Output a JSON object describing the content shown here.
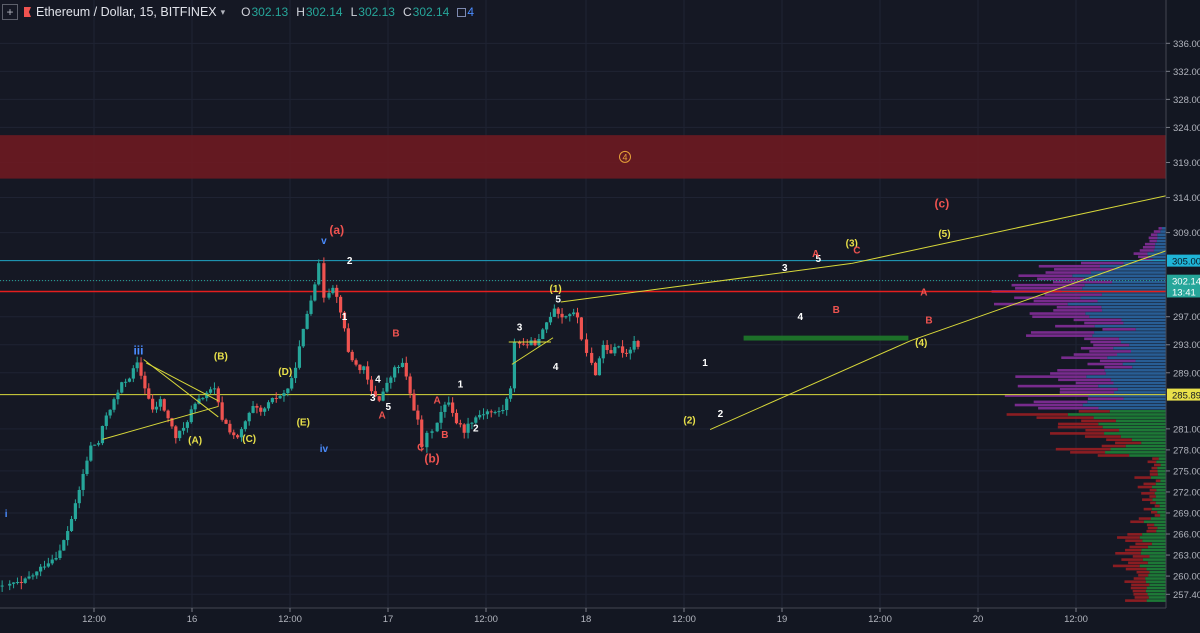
{
  "header": {
    "symbol_title": "Ethereum / Dollar, 15, BITFINEX",
    "open_label": "O",
    "open_value": "302.13",
    "high_label": "H",
    "high_value": "302.14",
    "low_label": "L",
    "low_value": "302.13",
    "close_label": "C",
    "close_value": "302.14",
    "indicator_count": "4"
  },
  "colors": {
    "background": "#131722",
    "up": "#26a69a",
    "down": "#ef5350",
    "resistance_zone": "#6b1a22",
    "trendline": "#d8d83a",
    "wave_white": "#ffffff",
    "wave_yellow": "#e8e04a",
    "wave_red": "#ef5350",
    "wave_blue": "#4a8cff"
  },
  "chart_data": {
    "type": "candlestick",
    "y_ticks": [
      "336.00",
      "332.00",
      "328.00",
      "324.00",
      "319.00",
      "314.00",
      "309.00",
      "305.00",
      "302.14",
      "297.00",
      "293.00",
      "289.00",
      "285.89",
      "281.00",
      "278.00",
      "275.00",
      "272.00",
      "269.00",
      "266.00",
      "263.00",
      "260.00",
      "257.40"
    ],
    "x_ticks": [
      "12:00",
      "16",
      "12:00",
      "17",
      "12:00",
      "18",
      "12:00",
      "19",
      "12:00",
      "20",
      "12:00"
    ],
    "last_price": "302.14",
    "countdown": "13:41",
    "line_305": "305.00",
    "line_285": "285.89",
    "zone_label": "4",
    "close_path": [
      [
        0.03,
        258.6
      ],
      [
        1.5,
        258.3
      ],
      [
        3,
        259
      ],
      [
        4.5,
        258.8
      ],
      [
        6,
        259.8
      ],
      [
        7.5,
        260.5
      ],
      [
        9,
        261.7
      ],
      [
        10.5,
        262.5
      ],
      [
        12,
        263.5
      ],
      [
        13.5,
        266.5
      ],
      [
        15,
        270
      ],
      [
        16.5,
        274.5
      ],
      [
        18,
        278.5
      ],
      [
        19.5,
        279
      ],
      [
        21,
        283
      ],
      [
        22.5,
        285
      ],
      [
        24,
        287.3
      ],
      [
        25.5,
        288.5
      ],
      [
        27,
        290.2
      ],
      [
        28.5,
        287
      ],
      [
        30,
        283.5
      ],
      [
        31.5,
        285
      ],
      [
        33,
        282.5
      ],
      [
        34.5,
        279.8
      ],
      [
        36,
        281
      ],
      [
        37.5,
        283.6
      ],
      [
        39,
        285
      ],
      [
        40.5,
        286.2
      ],
      [
        42,
        286.5
      ],
      [
        43.5,
        282.5
      ],
      [
        45,
        280.8
      ],
      [
        46.5,
        279.5
      ],
      [
        48,
        282
      ],
      [
        49.5,
        284
      ],
      [
        51,
        283.2
      ],
      [
        52.5,
        284.5
      ],
      [
        54,
        285.5
      ],
      [
        55.5,
        286
      ],
      [
        57,
        287.8
      ],
      [
        58.5,
        292.5
      ],
      [
        60,
        297.5
      ],
      [
        61.5,
        302
      ],
      [
        62.5,
        304.2
      ],
      [
        63.5,
        300
      ],
      [
        65,
        301.5
      ],
      [
        66.5,
        298
      ],
      [
        68,
        292
      ],
      [
        69.5,
        290
      ],
      [
        71,
        289.5
      ],
      [
        72.5,
        286.2
      ],
      [
        74,
        285.3
      ],
      [
        75.5,
        287.3
      ],
      [
        77,
        289.5
      ],
      [
        78.5,
        290.3
      ],
      [
        80,
        286
      ],
      [
        81.5,
        282
      ],
      [
        82.5,
        278.5
      ],
      [
        83.5,
        280
      ],
      [
        84.5,
        281
      ],
      [
        86,
        283.3
      ],
      [
        87.5,
        285
      ],
      [
        89,
        282
      ],
      [
        90.5,
        280.8
      ],
      [
        92,
        282.3
      ],
      [
        93.5,
        283.1
      ],
      [
        95,
        283.5
      ],
      [
        96.5,
        283.2
      ],
      [
        98,
        283.8
      ],
      [
        99.5,
        286.5
      ],
      [
        100.5,
        293.6
      ],
      [
        102,
        293
      ],
      [
        103.5,
        293.2
      ],
      [
        105,
        293.5
      ],
      [
        106.5,
        296.2
      ],
      [
        108,
        298.4
      ],
      [
        109.5,
        297
      ],
      [
        111,
        297.5
      ],
      [
        112.5,
        297
      ],
      [
        113.5,
        294
      ],
      [
        114.5,
        291.5
      ],
      [
        116,
        289
      ],
      [
        117.5,
        293
      ],
      [
        119,
        292
      ],
      [
        120.5,
        292.5
      ],
      [
        122,
        291.8
      ],
      [
        123.5,
        293.5
      ],
      [
        125,
        292.5
      ],
      [
        126.5,
        293
      ],
      [
        128,
        291.5
      ],
      [
        129.5,
        293
      ],
      [
        131,
        293
      ],
      [
        132.5,
        292.5
      ],
      [
        134,
        289.5
      ],
      [
        135.5,
        283.8
      ],
      [
        137,
        281.8
      ],
      [
        138.5,
        284.8
      ],
      [
        140,
        286.8
      ],
      [
        141,
        283.2
      ],
      [
        142.5,
        285
      ],
      [
        144,
        288
      ],
      [
        145.5,
        290.8
      ],
      [
        147,
        293.6
      ],
      [
        148.5,
        295.5
      ],
      [
        150,
        297
      ],
      [
        151.5,
        298.5
      ],
      [
        153,
        299
      ],
      [
        154,
        301
      ],
      [
        155.5,
        300
      ],
      [
        157,
        298.2
      ],
      [
        158.5,
        297.9
      ],
      [
        160,
        302.4
      ],
      [
        161.5,
        300.5
      ],
      [
        163,
        300.5
      ],
      [
        164.5,
        301.2
      ],
      [
        165.5,
        302.5
      ],
      [
        167,
        298
      ],
      [
        168.5,
        298.3
      ],
      [
        170,
        299.5
      ],
      [
        171.5,
        300.2
      ],
      [
        173,
        298
      ],
      [
        174.5,
        297
      ],
      [
        175.5,
        293.5
      ],
      [
        176.5,
        296
      ],
      [
        178,
        299.5
      ],
      [
        179.5,
        300.5
      ],
      [
        180.5,
        303.5
      ],
      [
        181.5,
        305
      ],
      [
        182.5,
        300
      ],
      [
        183.5,
        304.5
      ],
      [
        184.5,
        302.5
      ],
      [
        185.5,
        302.1
      ],
      [
        187,
        302.14
      ]
    ],
    "trendlines": [
      [
        [
          27.5,
          290.9
        ],
        [
          42,
          282.7
        ]
      ],
      [
        [
          28,
          290.4
        ],
        [
          42,
          285.0
        ]
      ],
      [
        [
          19.5,
          279.5
        ],
        [
          42,
          284.2
        ]
      ],
      [
        [
          108.5,
          299.1
        ],
        [
          165,
          304.6
        ]
      ],
      [
        [
          165,
          304.6
        ],
        [
          232,
          315.2
        ]
      ],
      [
        [
          137.5,
          280.9
        ],
        [
          176.5,
          293.6
        ]
      ],
      [
        [
          176.5,
          293.6
        ],
        [
          245,
          311.3
        ]
      ],
      [
        [
          98.4,
          293.4
        ],
        [
          106.6,
          293.4
        ]
      ],
      [
        [
          99,
          290.2
        ],
        [
          107,
          294.0
        ]
      ]
    ],
    "green_zone": [
      [
        144,
        293.6
      ],
      [
        176,
        294.3
      ]
    ],
    "wave_labels": [
      {
        "t": "i",
        "d": 0.8,
        "p": 268.4,
        "c": "blue"
      },
      {
        "t": "iii",
        "d": 26.5,
        "p": 291.6,
        "c": "blue"
      },
      {
        "t": "v",
        "d": 62.5,
        "p": 307.4,
        "c": "blue"
      },
      {
        "t": "iv",
        "d": 62.5,
        "p": 277.7,
        "c": "blue"
      },
      {
        "t": "(a)",
        "d": 65,
        "p": 308.8,
        "c": "red"
      },
      {
        "t": "(b)",
        "d": 83.5,
        "p": 276.2,
        "c": "red"
      },
      {
        "t": "(c)",
        "d": 182.5,
        "p": 312.6,
        "c": "red"
      },
      {
        "t": "(B)",
        "d": 42.5,
        "p": 290.9,
        "c": "yellow"
      },
      {
        "t": "(D)",
        "d": 55,
        "p": 288.7,
        "c": "yellow"
      },
      {
        "t": "(A)",
        "d": 37.5,
        "p": 278.9,
        "c": "yellow"
      },
      {
        "t": "(C)",
        "d": 48,
        "p": 279.1,
        "c": "yellow"
      },
      {
        "t": "(E)",
        "d": 58.5,
        "p": 281.5,
        "c": "yellow"
      },
      {
        "t": "(1)",
        "d": 107.5,
        "p": 300.5,
        "c": "yellow"
      },
      {
        "t": "(2)",
        "d": 133.5,
        "p": 281.8,
        "c": "yellow"
      },
      {
        "t": "(3)",
        "d": 165,
        "p": 307.0,
        "c": "yellow"
      },
      {
        "t": "(4)",
        "d": 178.5,
        "p": 292.8,
        "c": "yellow"
      },
      {
        "t": "(5)",
        "d": 183,
        "p": 308.4,
        "c": "yellow"
      },
      {
        "t": "2",
        "d": 67.5,
        "p": 304.5,
        "c": "white"
      },
      {
        "t": "1",
        "d": 66.5,
        "p": 296.5,
        "c": "white"
      },
      {
        "t": "4",
        "d": 73,
        "p": 287.6,
        "c": "white"
      },
      {
        "t": "3",
        "d": 72,
        "p": 285.0,
        "c": "white"
      },
      {
        "t": "5",
        "d": 75,
        "p": 283.7,
        "c": "white"
      },
      {
        "t": "1",
        "d": 89,
        "p": 286.9,
        "c": "white"
      },
      {
        "t": "2",
        "d": 92,
        "p": 280.6,
        "c": "white"
      },
      {
        "t": "3",
        "d": 100.5,
        "p": 295.0,
        "c": "white"
      },
      {
        "t": "4",
        "d": 107.5,
        "p": 289.4,
        "c": "white"
      },
      {
        "t": "5",
        "d": 108,
        "p": 299.0,
        "c": "white"
      },
      {
        "t": "1",
        "d": 136.5,
        "p": 290.0,
        "c": "white"
      },
      {
        "t": "2",
        "d": 139.5,
        "p": 282.7,
        "c": "white"
      },
      {
        "t": "3",
        "d": 152,
        "p": 303.5,
        "c": "white"
      },
      {
        "t": "4",
        "d": 155,
        "p": 296.5,
        "c": "white"
      },
      {
        "t": "5",
        "d": 158.5,
        "p": 304.8,
        "c": "white"
      },
      {
        "t": "B",
        "d": 76.5,
        "p": 294.2,
        "c": "red"
      },
      {
        "t": "A",
        "d": 84.5,
        "p": 284.6,
        "c": "red"
      },
      {
        "t": "C",
        "d": 81.3,
        "p": 277.9,
        "c": "red"
      },
      {
        "t": "B",
        "d": 86,
        "p": 279.7,
        "c": "red"
      },
      {
        "t": "A",
        "d": 73.8,
        "p": 282.5,
        "c": "red"
      },
      {
        "t": "A",
        "d": 158,
        "p": 305.5,
        "c": "red"
      },
      {
        "t": "C",
        "d": 166,
        "p": 306.0,
        "c": "red"
      },
      {
        "t": "B",
        "d": 162,
        "p": 297.5,
        "c": "red"
      },
      {
        "t": "A",
        "d": 179,
        "p": 300.0,
        "c": "red"
      },
      {
        "t": "B",
        "d": 180,
        "p": 296.0,
        "c": "red"
      }
    ],
    "volume_profile_note": "horizontal volume profile on right side, up/down volume split by price level"
  }
}
